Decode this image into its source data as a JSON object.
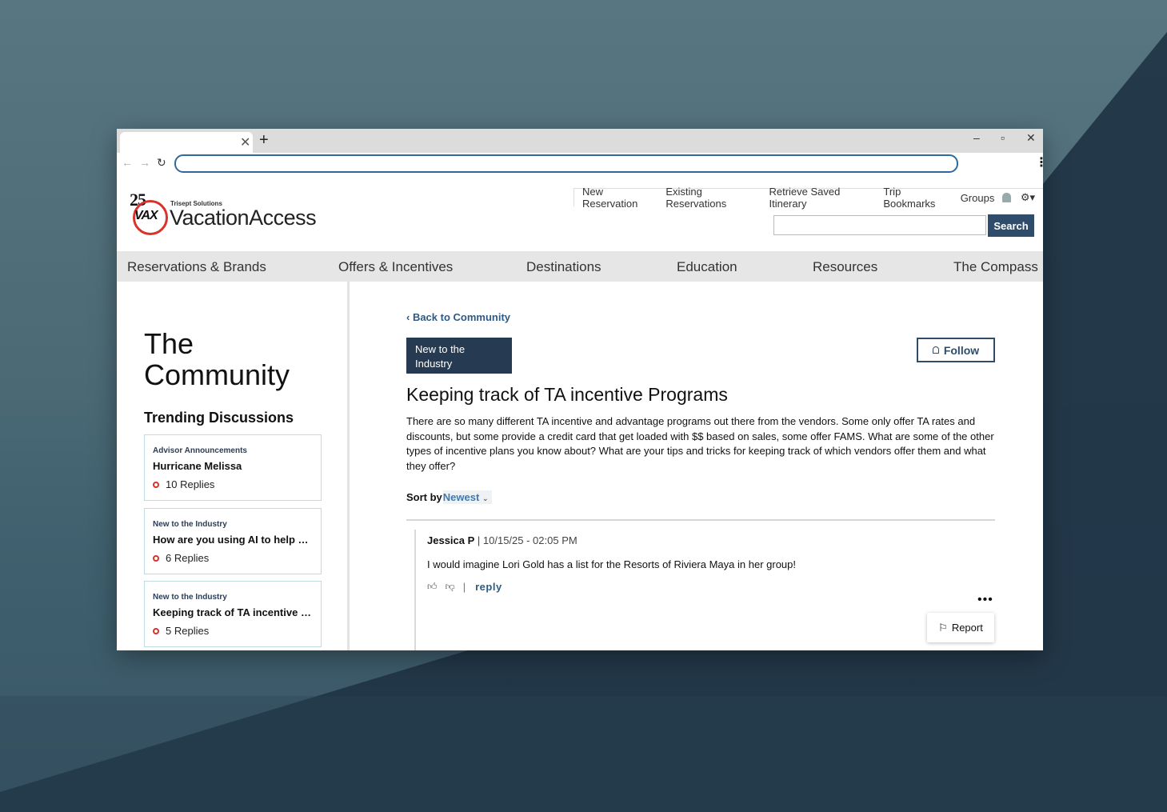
{
  "browser": {
    "tab_close": "✕",
    "new_tab": "+",
    "minimize": "–",
    "maximize": "▫",
    "close": "✕",
    "back": "←",
    "forward": "→",
    "reload": "↻",
    "menu": "⋮"
  },
  "logo": {
    "anniversary": "25",
    "badge": "VAX",
    "parent": "Trisept Solutions",
    "name": "VacationAccess"
  },
  "utility_nav": [
    "New Reservation",
    "Existing Reservations",
    "Retrieve Saved Itinerary",
    "Trip Bookmarks",
    "Groups"
  ],
  "search": {
    "placeholder": "",
    "button": "Search"
  },
  "main_nav": [
    "Reservations & Brands",
    "Offers & Incentives",
    "Destinations",
    "Education",
    "Resources",
    "The Compass"
  ],
  "sidebar": {
    "title_line1": "The",
    "title_line2": "Community",
    "trending_heading": "Trending Discussions",
    "cards": [
      {
        "category": "Advisor Announcements",
        "title": "Hurricane Melissa",
        "replies": "10 Replies"
      },
      {
        "category": "New to the Industry",
        "title": "How are you using AI to help your business?",
        "replies": "6 Replies"
      },
      {
        "category": "New to the Industry",
        "title": "Keeping track of TA incentive Programs",
        "replies": "5 Replies"
      }
    ]
  },
  "post": {
    "back_link": "‹ Back to Community",
    "category": "New to the Industry",
    "follow": "Follow",
    "title": "Keeping track of TA incentive Programs",
    "body": "There are so many different TA incentive and advantage programs out there from the vendors.   Some only offer TA rates and discounts, but some provide a credit card that get loaded with $$ based on sales, some offer FAMS.  What are some of the other types of incentive plans you know about?  What are your tips and tricks for keeping track of which vendors offer them and what they offer?",
    "sort_label": "Sort by",
    "sort_value": "Newest"
  },
  "comment": {
    "author": "Jessica P",
    "timestamp": "| 10/15/25 - 02:05 PM",
    "text": "I would imagine Lori Gold has a list for the Resorts of Riviera Maya in her group!",
    "reply": "reply",
    "more": "•••",
    "report": "Report"
  },
  "colors": {
    "brand_navy": "#263b52",
    "accent_red": "#d9322b",
    "link_blue": "#2e5a84"
  }
}
